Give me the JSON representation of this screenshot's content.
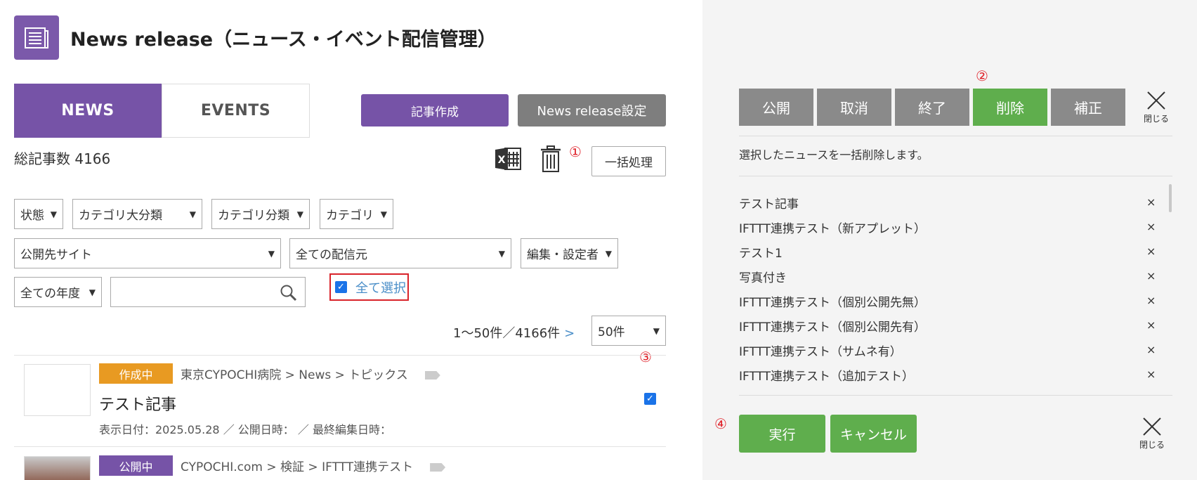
{
  "header": {
    "title": "News release（ニュース・イベント配信管理）"
  },
  "tabs": [
    {
      "label": "NEWS"
    },
    {
      "label": "EVENTS"
    }
  ],
  "toolbar": {
    "create_label": "記事作成",
    "settings_label": "News release設定",
    "bulk_label": "一括処理"
  },
  "summary": {
    "total_label": "総記事数 4166"
  },
  "markers": {
    "m1": "①",
    "m2": "②",
    "m3": "③",
    "m4": "④"
  },
  "filters": {
    "status": "状態",
    "category_major": "カテゴリ大分類",
    "category_class": "カテゴリ分類",
    "category": "カテゴリ",
    "site": "公開先サイト",
    "source": "全ての配信元",
    "editor": "編集・設定者",
    "year": "全ての年度",
    "search_value": ""
  },
  "select_all": {
    "label": "全て選択",
    "checked": true
  },
  "pagination": {
    "range": "1〜50件／4166件",
    "next": ">",
    "per_page": "50件"
  },
  "items": [
    {
      "status": "作成中",
      "breadcrumb": "東京CYPOCHI病院 > News > トピックス",
      "title": "テスト記事",
      "meta": "表示日付：2025.05.28 ／ 公開日時： ／ 最終編集日時：",
      "checked": true
    },
    {
      "status": "公開中",
      "breadcrumb": "CYPOCHI.com > 検証 > IFTTT連携テスト"
    }
  ],
  "panel": {
    "actions": [
      "公開",
      "取消",
      "終了",
      "削除",
      "補正"
    ],
    "active_action": "削除",
    "close_label": "閉じる",
    "description": "選択したニュースを一括削除します。",
    "selected": [
      "テスト記事",
      "IFTTT連携テスト（新アプレット）",
      "テスト1",
      "写真付き",
      "IFTTT連携テスト（個別公開先無）",
      "IFTTT連携テスト（個別公開先有）",
      "IFTTT連携テスト（サムネ有）",
      "IFTTT連携テスト（追加テスト）"
    ],
    "remove_symbol": "×",
    "run_label": "実行",
    "cancel_label": "キャンセル"
  },
  "colors": {
    "purple": "#7653a7",
    "green": "#5fae4d",
    "gray": "#8a8a8a",
    "orange": "#e89a22",
    "red": "#d9232a"
  }
}
